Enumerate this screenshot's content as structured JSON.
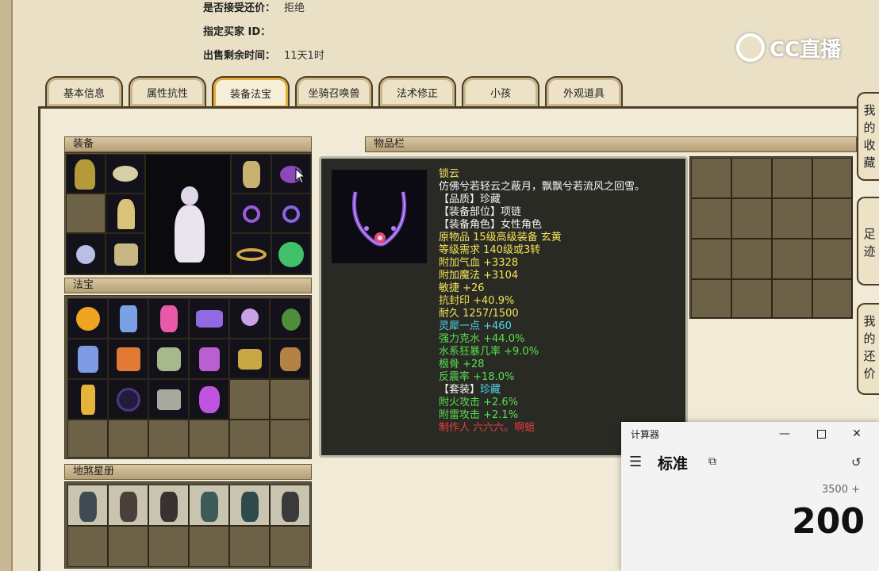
{
  "header": {
    "accept_counter_label": "是否接受还价：",
    "accept_counter_value": "拒绝",
    "buyer_id_label": "指定买家 ID：",
    "buyer_id_value": "",
    "remaining_label": "出售剩余时间：",
    "remaining_value": "11天1时"
  },
  "logo_text": "CC直播",
  "tabs": [
    {
      "label": "基本信息"
    },
    {
      "label": "属性抗性"
    },
    {
      "label": "装备法宝"
    },
    {
      "label": "坐骑召唤兽"
    },
    {
      "label": "法术修正"
    },
    {
      "label": "小孩"
    },
    {
      "label": "外观道具"
    }
  ],
  "active_tab": "装备法宝",
  "sections": {
    "equipment": "装备",
    "treasure": "法宝",
    "star_book": "地煞星册",
    "inventory": "物品栏"
  },
  "tooltip": {
    "name": "锁云",
    "lines": [
      {
        "text": "锁云",
        "color": "yellow"
      },
      {
        "text": "仿佛兮若轻云之蔽月，飘飘兮若流风之回雪。",
        "color": "white"
      },
      {
        "text": "【品质】珍藏",
        "color": "white"
      },
      {
        "text": "【装备部位】项链",
        "color": "white"
      },
      {
        "text": "【装备角色】女性角色",
        "color": "white"
      },
      {
        "text": "原物品 15级高级装备 玄黄",
        "color": "yellow"
      },
      {
        "text": "等级需求 140级或3转",
        "color": "yellow"
      },
      {
        "text": "附加气血 +3328",
        "color": "yellow"
      },
      {
        "text": "附加魔法 +3104",
        "color": "yellow"
      },
      {
        "text": "敏捷 +26",
        "color": "yellow"
      },
      {
        "text": "抗封印 +40.9%",
        "color": "yellow"
      },
      {
        "text": "耐久 1257/1500",
        "color": "yellow"
      },
      {
        "text": "灵犀一点 +460",
        "color": "cyan"
      },
      {
        "text": "强力克水 +44.0%",
        "color": "green"
      },
      {
        "text": "水系狂暴几率 +9.0%",
        "color": "green"
      },
      {
        "text": "根骨 +28",
        "color": "green"
      },
      {
        "text": "反震率 +18.0%",
        "color": "green"
      },
      {
        "text": " ",
        "color": "white"
      },
      {
        "text": "【套装】珍藏",
        "color": "white",
        "suffix": "珍藏"
      },
      {
        "text": "附火攻击 +2.6%",
        "color": "green"
      },
      {
        "text": "附雷攻击 +2.1%",
        "color": "green"
      },
      {
        "text": "制作人 六六六。啊蛆",
        "color": "red"
      }
    ]
  },
  "side_tabs": [
    {
      "label": "我的收藏"
    },
    {
      "label": "足迹"
    },
    {
      "label": "我的还价"
    }
  ],
  "calculator": {
    "window_title": "计算器",
    "mode": "标准",
    "expression": "3500 +",
    "result": "200"
  }
}
